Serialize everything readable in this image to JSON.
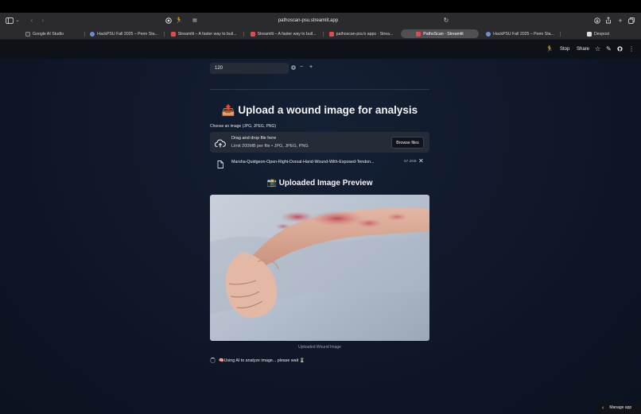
{
  "browser": {
    "url": "pathoscan-psu.streamlit.app",
    "tabs": [
      {
        "label": "Google AI Studio",
        "color": "#3c3c40"
      },
      {
        "label": "HackPSU Fall 2025 – Penn Sta...",
        "color": "#6a8fd6"
      },
      {
        "label": "Streamlit – A faster way to buil...",
        "color": "#e5484d"
      },
      {
        "label": "Streamlit – A faster way to buil...",
        "color": "#e5484d"
      },
      {
        "label": "pathoscan-psu's apps · Strea...",
        "color": "#e5484d"
      },
      {
        "label": "PathoScan · Streamlit",
        "color": "#e5484d"
      },
      {
        "label": "HackPSU Fall 2025 – Penn Sta...",
        "color": "#6a8fd6"
      },
      {
        "label": "Devpost",
        "color": "#e0e0e0"
      }
    ]
  },
  "header": {
    "stop_label": "Stop",
    "share_label": "Share"
  },
  "form": {
    "number_value": "120",
    "minus": "−",
    "plus": "+"
  },
  "upload": {
    "heading": "📤 Upload a wound image for analysis",
    "choose_label": "Choose an image (JPG, JPEG, PNG)",
    "drop_title": "Drag and drop file here",
    "drop_limits": "Limit 200MB per file • JPG, JPEG, PNG",
    "browse_label": "Browse files",
    "file_name": "Marsha-Quidgeon-Open-Right-Dorsal-Hand-Wound-With-Exposed-Tendon...",
    "file_size": "57.2KB",
    "remove": "✕"
  },
  "preview": {
    "heading": "📸 Uploaded Image Preview",
    "caption": "Uploaded Wound Image"
  },
  "status": {
    "text": "🧠Using AI to analyze image... please wait ⌛"
  },
  "footer": {
    "manage_label": "Manage app"
  }
}
